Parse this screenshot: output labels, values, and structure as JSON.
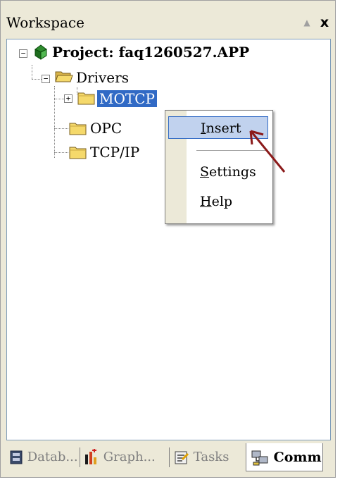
{
  "window": {
    "title": "Workspace",
    "pin_glyph": "▲",
    "close_glyph": "x"
  },
  "tree": {
    "project_label": "Project: faq1260527.APP",
    "drivers_label": "Drivers",
    "motcp_label": "MOTCP",
    "opc_label": "OPC",
    "tcpip_label": "TCP/IP",
    "expander_minus": "−",
    "expander_plus": "+"
  },
  "context_menu": {
    "insert_label": "Insert",
    "insert_mnemonic": "I",
    "insert_rest": "nsert",
    "settings_mnemonic": "S",
    "settings_rest": "ettings",
    "help_mnemonic": "H",
    "help_rest": "elp"
  },
  "tabs": [
    {
      "label": "Datab...",
      "icon": "database-icon",
      "active": false
    },
    {
      "label": "Graph...",
      "icon": "graph-icon",
      "active": false
    },
    {
      "label": "Tasks",
      "icon": "tasks-icon",
      "active": false
    },
    {
      "label": "Comm",
      "icon": "comm-icon",
      "active": true
    }
  ],
  "colors": {
    "selection": "#316ac5",
    "menu_highlight": "#c1d2ee",
    "arrow": "#8b1a1a",
    "folder": "#f5d96b"
  }
}
